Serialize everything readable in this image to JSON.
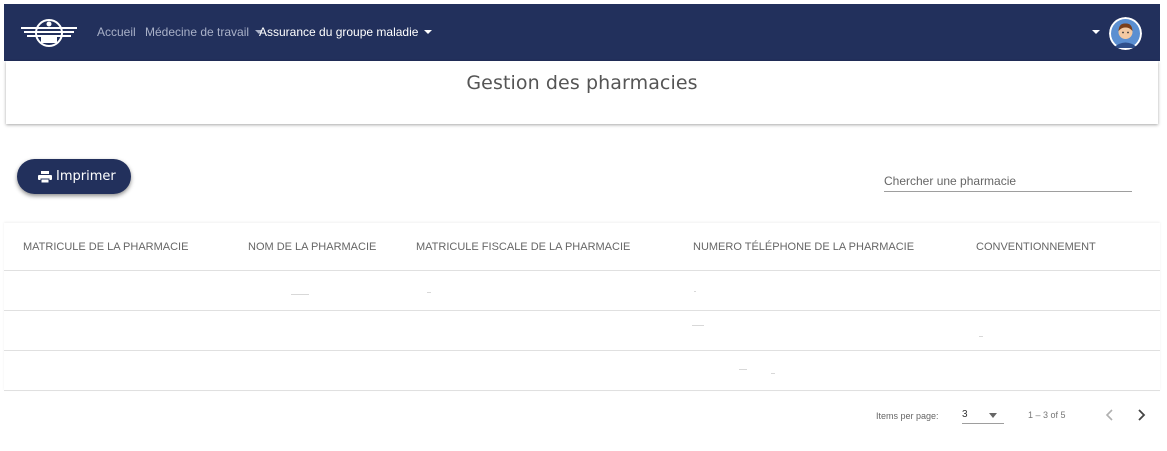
{
  "navbar": {
    "logo_icon": "logo-icon",
    "links": [
      {
        "label": "Accueil"
      },
      {
        "label": "Médecine de travail"
      },
      {
        "label": "Assurance du groupe maladie"
      }
    ],
    "avatar_icon": "avatar-icon",
    "background": "#22305c"
  },
  "page": {
    "title": "Gestion des pharmacies"
  },
  "toolbar": {
    "print_label": "Imprimer",
    "print_icon": "printer-icon",
    "search_placeholder": "Chercher une pharmacie"
  },
  "table": {
    "columns": [
      "MATRICULE DE LA PHARMACIE",
      "NOM DE LA PHARMACIE",
      "MATRICULE FISCALE DE LA PHARMACIE",
      "NUMERO TÉLÉPHONE DE LA PHARMACIE",
      "CONVENTIONNEMENT"
    ]
  },
  "paginator": {
    "items_per_page_label": "Items per page:",
    "items_per_page_value": "3",
    "range_label": "1 – 3 of 5",
    "prev_icon": "chevron-left-icon",
    "next_icon": "chevron-right-icon"
  }
}
